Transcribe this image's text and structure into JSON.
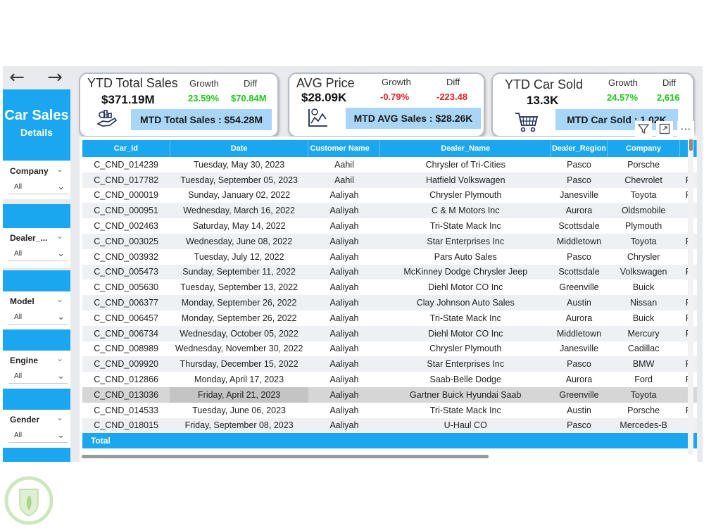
{
  "nav": {
    "back_glyph": "←",
    "forward_glyph": "→"
  },
  "sidebar": {
    "title": "Car Sales",
    "subtitle": "Details",
    "slicers": [
      {
        "label": "Company",
        "value": "All"
      },
      {
        "label": "Dealer_...",
        "value": "All"
      },
      {
        "label": "Model",
        "value": "All"
      },
      {
        "label": "Engine",
        "value": "All"
      },
      {
        "label": "Gender",
        "value": "All"
      }
    ]
  },
  "cards": {
    "ytd_sales": {
      "title": "YTD Total Sales",
      "value": "$371.19M",
      "growth_label": "Growth",
      "diff_label": "Diff",
      "growth": "23.59%",
      "diff": "$70.84M",
      "mtd": "MTD Total Sales : $54.28M"
    },
    "avg_price": {
      "title": "AVG Price",
      "value": "$28.09K",
      "growth_label": "Growth",
      "diff_label": "Diff",
      "growth": "-0.79%",
      "diff": "-223.48",
      "mtd": "MTD AVG Sales : $28.26K"
    },
    "cars_sold": {
      "title": "YTD Car Sold",
      "value": "13.3K",
      "growth_label": "Growth",
      "diff_label": "Diff",
      "growth": "24.57%",
      "diff": "2,616",
      "mtd": "MTD Car Sold : 1.02K"
    }
  },
  "colors": {
    "accent": "#1aa7ef",
    "positive": "#22c722",
    "negative": "#e82020",
    "mtd_bg": "#a9d6f7"
  },
  "icons": {
    "sales": "hand-money-icon",
    "price": "price-chart-icon",
    "sold": "shopping-cart-icon",
    "filter": "filter-icon",
    "focus": "focus-mode-icon",
    "more": "more-options-icon"
  },
  "table": {
    "columns": [
      "Car_id",
      "Date",
      "Customer Name",
      "Dealer_Name",
      "Dealer_Region",
      "Company",
      ""
    ],
    "sort_column": "Customer Name",
    "rows": [
      [
        "C_CND_014239",
        "Tuesday, May 30, 2023",
        "Aahil",
        "Chrysler of Tri-Cities",
        "Pasco",
        "Porsche",
        ""
      ],
      [
        "C_CND_017782",
        "Tuesday, September 05, 2023",
        "Aahil",
        "Hatfield Volkswagen",
        "Pasco",
        "Chevrolet",
        "F"
      ],
      [
        "C_CND_000019",
        "Sunday, January 02, 2022",
        "Aaliyah",
        "Chrysler Plymouth",
        "Janesville",
        "Toyota",
        "F"
      ],
      [
        "C_CND_000951",
        "Wednesday, March 16, 2022",
        "Aaliyah",
        "C & M Motors Inc",
        "Aurora",
        "Oldsmobile",
        ""
      ],
      [
        "C_CND_002463",
        "Saturday, May 14, 2022",
        "Aaliyah",
        "Tri-State Mack Inc",
        "Scottsdale",
        "Plymouth",
        ""
      ],
      [
        "C_CND_003025",
        "Wednesday, June 08, 2022",
        "Aaliyah",
        "Star Enterprises Inc",
        "Middletown",
        "Toyota",
        "F"
      ],
      [
        "C_CND_003932",
        "Tuesday, July 12, 2022",
        "Aaliyah",
        "Pars Auto Sales",
        "Pasco",
        "Chrysler",
        ""
      ],
      [
        "C_CND_005473",
        "Sunday, September 11, 2022",
        "Aaliyah",
        "McKinney Dodge Chrysler Jeep",
        "Scottsdale",
        "Volkswagen",
        "F"
      ],
      [
        "C_CND_005630",
        "Tuesday, September 13, 2022",
        "Aaliyah",
        "Diehl Motor CO Inc",
        "Greenville",
        "Buick",
        ""
      ],
      [
        "C_CND_006377",
        "Monday, September 26, 2022",
        "Aaliyah",
        "Clay Johnson Auto Sales",
        "Austin",
        "Nissan",
        "F"
      ],
      [
        "C_CND_006457",
        "Monday, September 26, 2022",
        "Aaliyah",
        "Tri-State Mack Inc",
        "Aurora",
        "Buick",
        "F"
      ],
      [
        "C_CND_006734",
        "Wednesday, October 05, 2022",
        "Aaliyah",
        "Diehl Motor CO Inc",
        "Middletown",
        "Mercury",
        "F"
      ],
      [
        "C_CND_008989",
        "Wednesday, November 30, 2022",
        "Aaliyah",
        "Chrysler Plymouth",
        "Janesville",
        "Cadillac",
        ""
      ],
      [
        "C_CND_009920",
        "Thursday, December 15, 2022",
        "Aaliyah",
        "Star Enterprises Inc",
        "Pasco",
        "BMW",
        "F"
      ],
      [
        "C_CND_012866",
        "Monday, April 17, 2023",
        "Aaliyah",
        "Saab-Belle Dodge",
        "Aurora",
        "Ford",
        "F"
      ],
      [
        "C_CND_013036",
        "Friday, April 21, 2023",
        "Aaliyah",
        "Gartner Buick Hyundai Saab",
        "Greenville",
        "Toyota",
        ""
      ],
      [
        "C_CND_014533",
        "Tuesday, June 06, 2023",
        "Aaliyah",
        "Tri-State Mack Inc",
        "Austin",
        "Porsche",
        "F"
      ],
      [
        "C_CND_018015",
        "Friday, September 08, 2023",
        "Aaliyah",
        "U-Haul CO",
        "Pasco",
        "Mercedes-B",
        ""
      ]
    ],
    "total_label": "Total"
  }
}
